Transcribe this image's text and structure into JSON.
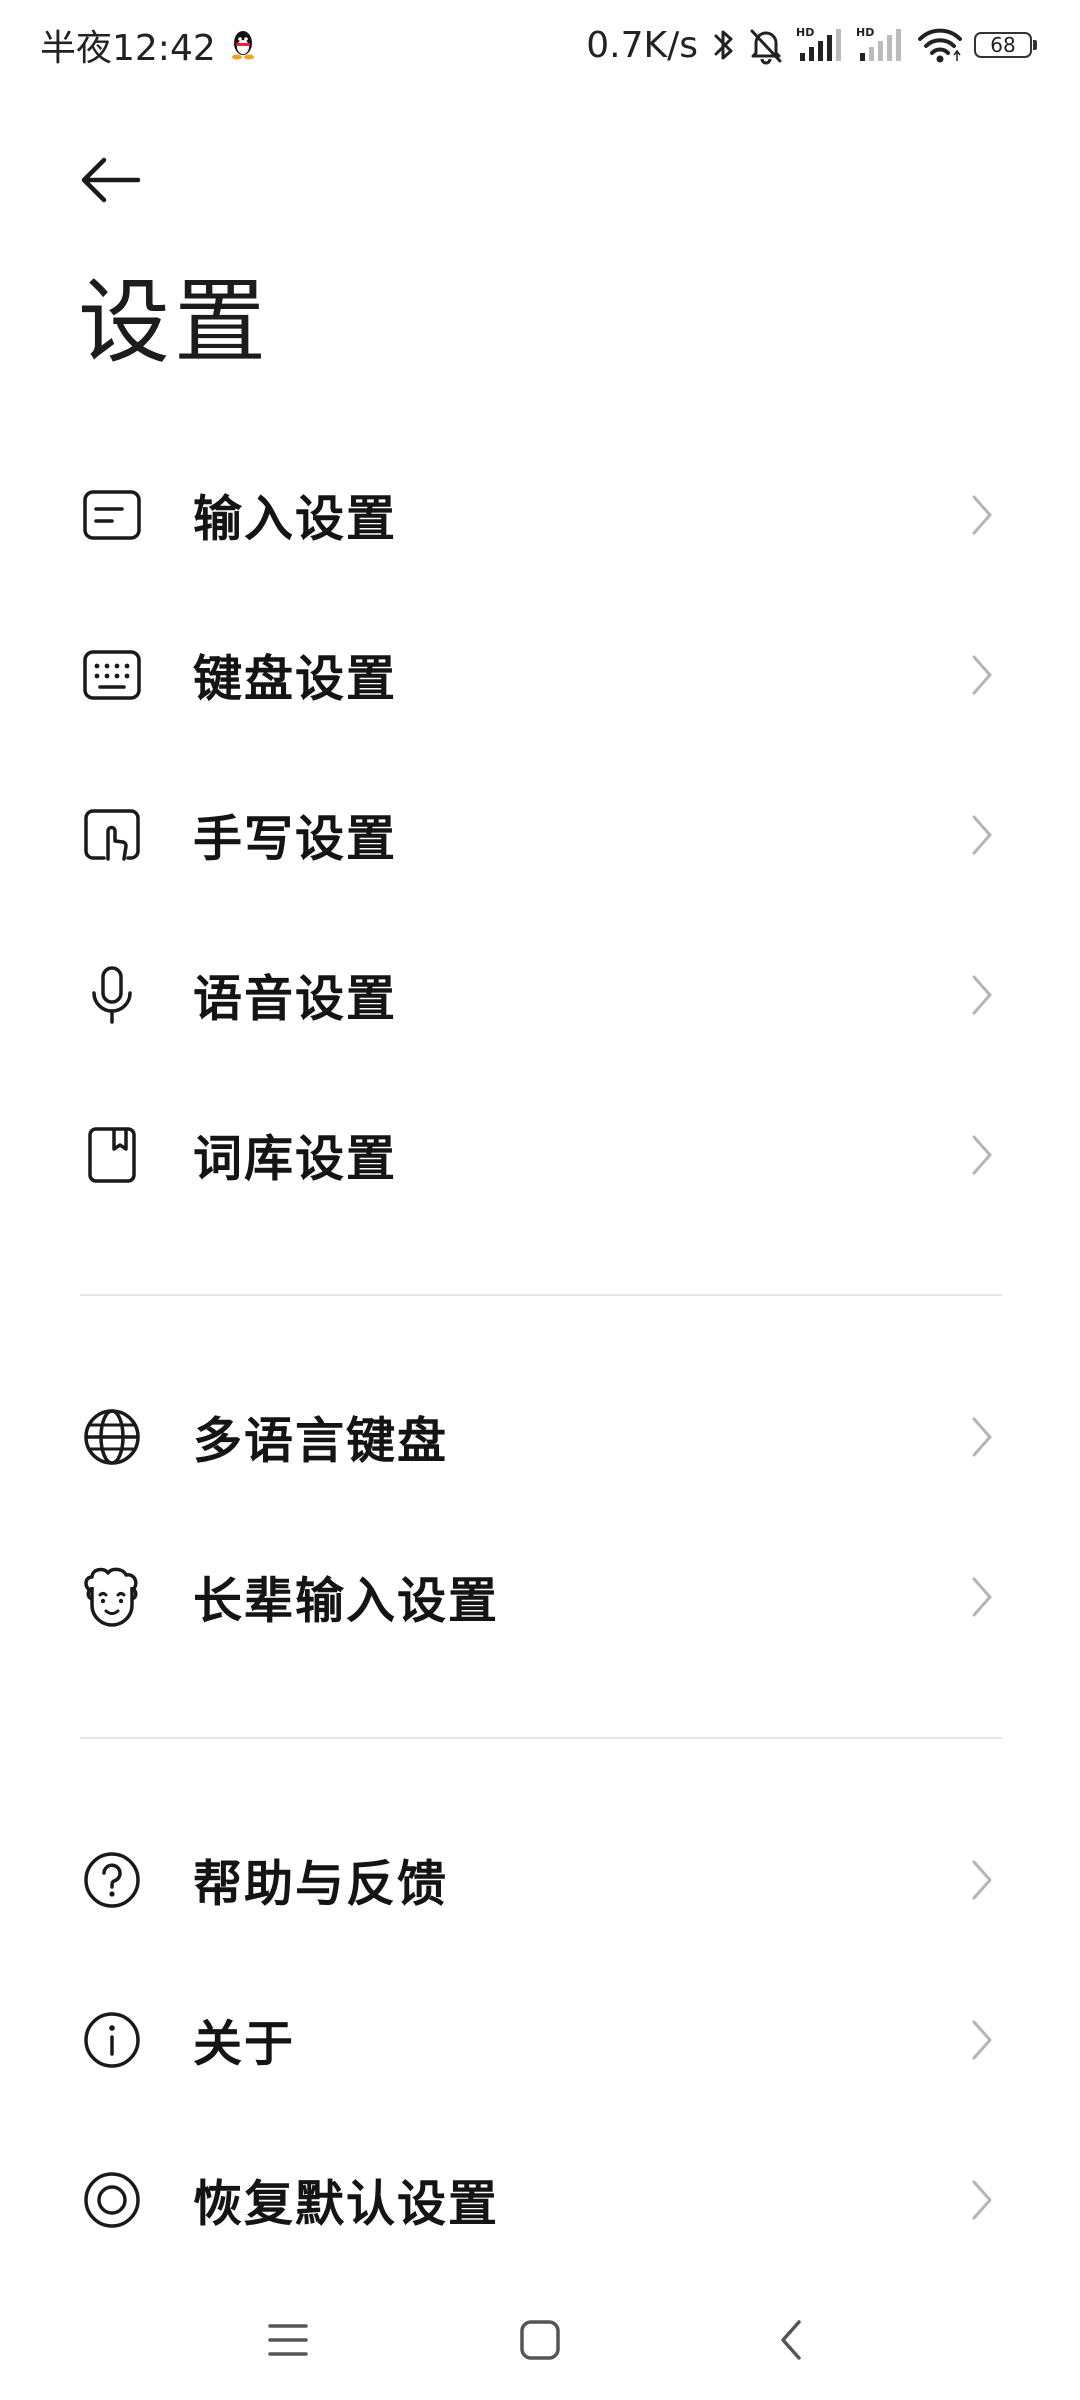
{
  "status_bar": {
    "time": "半夜12:42",
    "network_speed": "0.7K/s",
    "battery_level": "68",
    "icons": [
      "qq-icon",
      "bluetooth-icon",
      "mute-bell-icon",
      "hd-signal-icon",
      "hd-signal-icon",
      "wifi-icon",
      "battery-icon"
    ]
  },
  "header": {
    "title": "设置",
    "back_icon": "arrow-left-icon"
  },
  "menu": {
    "group1": [
      {
        "label": "输入设置",
        "icon": "input-box-icon"
      },
      {
        "label": "键盘设置",
        "icon": "keyboard-icon"
      },
      {
        "label": "手写设置",
        "icon": "handwriting-icon"
      },
      {
        "label": "语音设置",
        "icon": "microphone-icon"
      },
      {
        "label": "词库设置",
        "icon": "book-icon"
      }
    ],
    "group2": [
      {
        "label": "多语言键盘",
        "icon": "globe-icon"
      },
      {
        "label": "长辈输入设置",
        "icon": "elder-face-icon"
      }
    ],
    "group3": [
      {
        "label": "帮助与反馈",
        "icon": "question-circle-icon"
      },
      {
        "label": "关于",
        "icon": "info-circle-icon"
      },
      {
        "label": "恢复默认设置",
        "icon": "restore-circle-icon"
      }
    ]
  },
  "nav_bar": {
    "icons": [
      "menu-lines-icon",
      "home-square-icon",
      "back-chevron-icon"
    ]
  }
}
